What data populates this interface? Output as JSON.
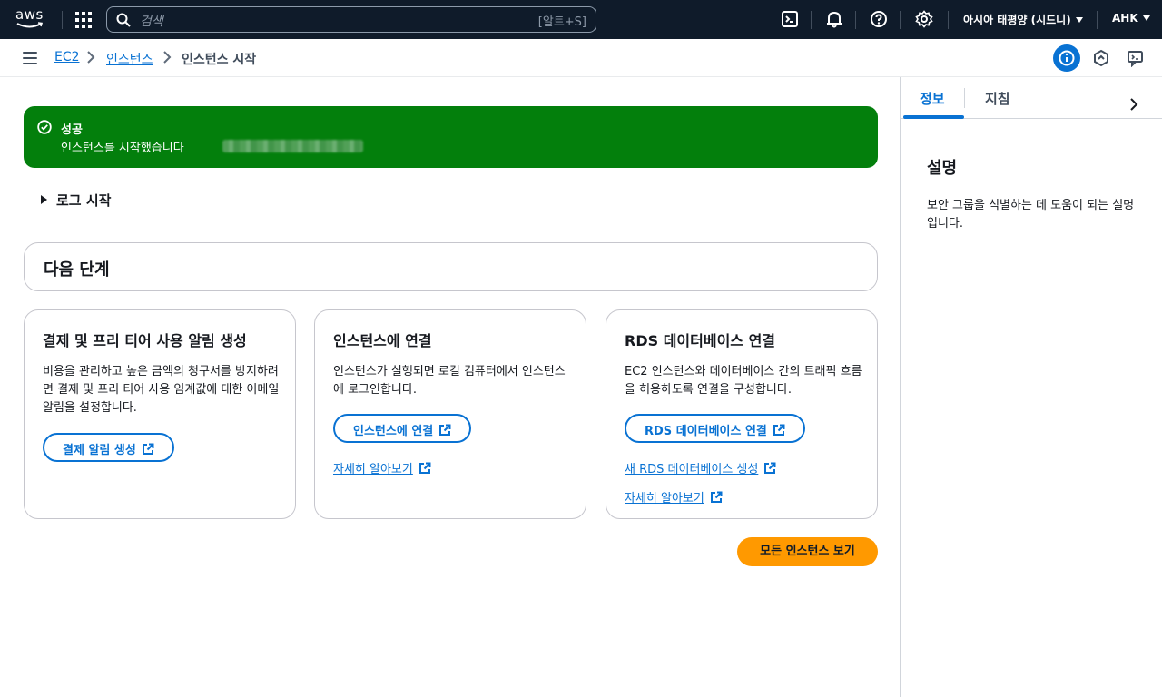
{
  "topnav": {
    "logo": "aws",
    "search_placeholder": "검색",
    "search_shortcut": "[알트+S]",
    "region": "아시아 태평양 (시드니)",
    "user": "AHK",
    "icons": [
      "services-grid-icon",
      "search-icon",
      "cloudshell-icon",
      "notifications-icon",
      "help-icon",
      "settings-icon"
    ]
  },
  "breadcrumb": {
    "items": [
      "EC2",
      "인스턴스",
      "인스턴스 시작"
    ],
    "separator": ">"
  },
  "flash": {
    "title": "성공",
    "message": "인스턴스를 시작했습니다",
    "color": "#037f0c"
  },
  "log_toggle": "로그 시작",
  "next_steps": {
    "title": "다음 단계"
  },
  "cards": [
    {
      "title": "결제 및 프리 티어 사용 알림 생성",
      "description": "비용을 관리하고 높은 금액의 청구서를 방지하려면 결제 및 프리 티어 사용 임계값에 대한 이메일 알림을 설정합니다.",
      "button": "결제 알림 생성"
    },
    {
      "title": "인스턴스에 연결",
      "description": "인스턴스가 실행되면 로컬 컴퓨터에서 인스턴스에 로그인합니다.",
      "button": "인스턴스에 연결",
      "links": [
        "자세히 알아보기"
      ]
    },
    {
      "title": "RDS 데이터베이스 연결",
      "description": "EC2 인스턴스와 데이터베이스 간의 트래픽 흐름을 허용하도록 연결을 구성합니다.",
      "button": "RDS 데이터베이스 연결",
      "links": [
        "새 RDS 데이터베이스 생성",
        "자세히 알아보기"
      ]
    }
  ],
  "primary_button": "모든 인스턴스 보기",
  "side_panel": {
    "tabs": [
      "정보",
      "지침"
    ],
    "active_tab": "정보",
    "title": "설명",
    "text": "보안 그룹을 식별하는 데 도움이 되는 설명입니다."
  },
  "colors": {
    "nav_bg": "#0f1b2a",
    "link": "#0972d3",
    "primary": "#ff9900",
    "success": "#037f0c"
  }
}
